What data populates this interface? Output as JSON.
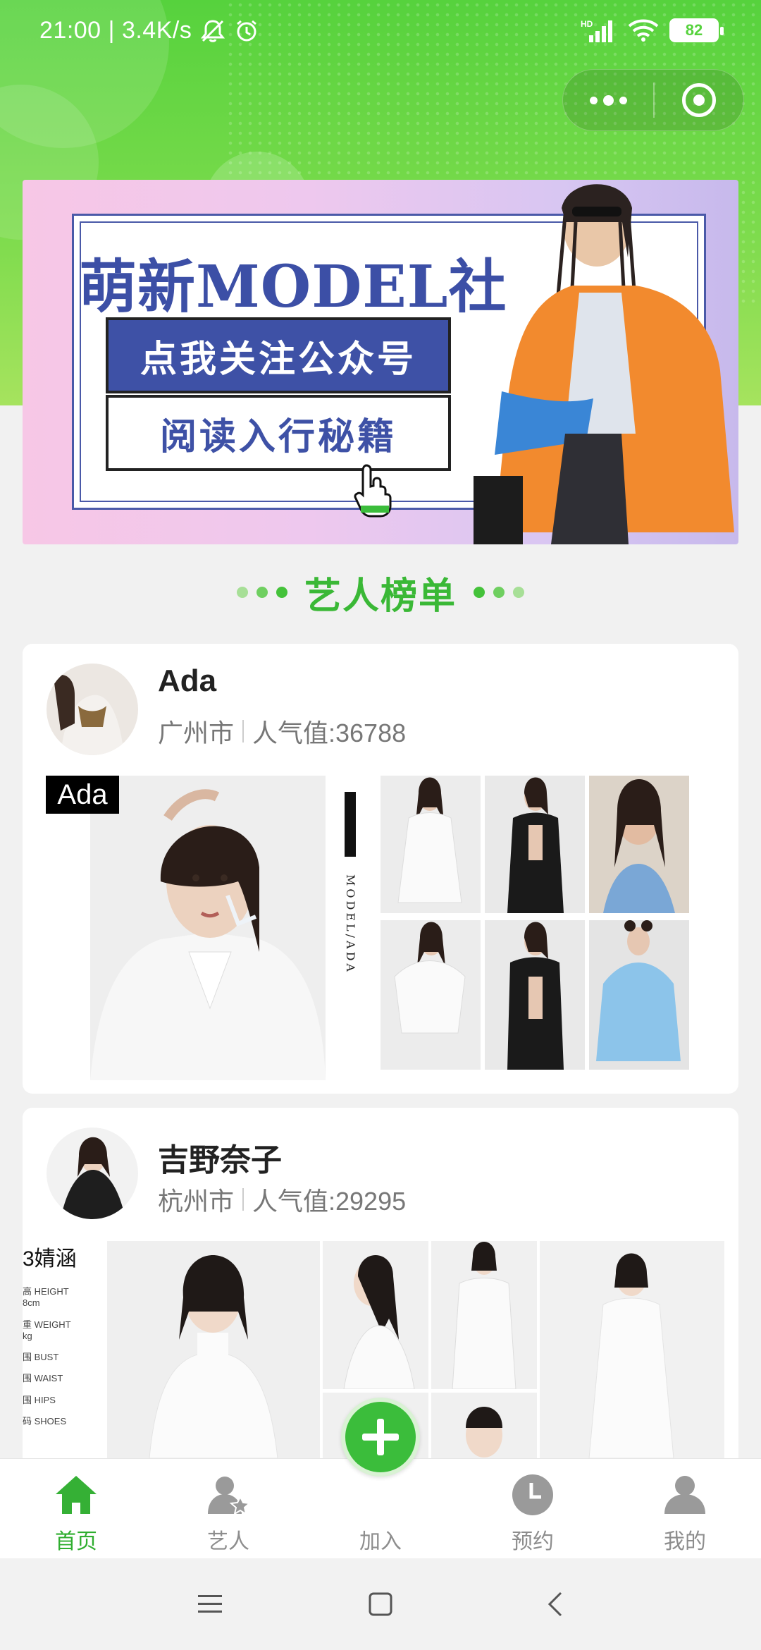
{
  "status_bar": {
    "time": "21:00",
    "speed": "3.4K/s",
    "separator": "|",
    "signal_label": "HD",
    "battery": "82"
  },
  "banner": {
    "title": "萌新MODEL社",
    "button_primary": "点我关注公众号",
    "button_secondary": "阅读入行秘籍"
  },
  "section": {
    "title": "艺人榜单"
  },
  "artists": [
    {
      "name": "Ada",
      "city": "广州市",
      "popularity": "人气值:36788",
      "photo_tag": "Ada",
      "vertical_text": "MODEL/ADA"
    },
    {
      "name": "吉野奈子",
      "city": "杭州市",
      "popularity": "人气值:29295",
      "spec_name": "3婧涵",
      "spec_lines": [
        "高 HEIGHT",
        "8cm",
        "重 WEIGHT",
        "kg",
        "围 BUST",
        "围 WAIST",
        "围 HIPS",
        "码 SHOES"
      ]
    }
  ],
  "tabbar": {
    "items": [
      {
        "label": "首页",
        "icon": "home-icon",
        "active": true
      },
      {
        "label": "艺人",
        "icon": "artist-icon",
        "active": false
      },
      {
        "label": "加入",
        "icon": "plus-icon",
        "active": false
      },
      {
        "label": "预约",
        "icon": "clock-icon",
        "active": false
      },
      {
        "label": "我的",
        "icon": "user-icon",
        "active": false
      }
    ]
  },
  "colors": {
    "accent": "#3bbd3b",
    "header": "#56d23d",
    "banner_blue": "#3e51a6"
  }
}
